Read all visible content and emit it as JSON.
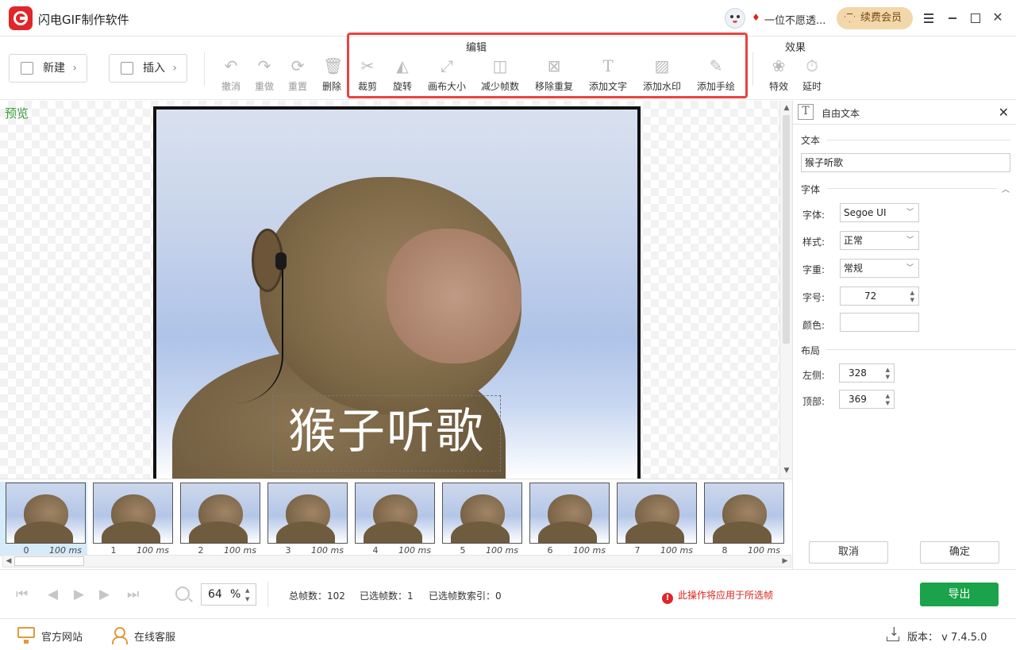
{
  "app": {
    "title": "闪电GIF制作软件",
    "username": "一位不愿透...",
    "renew_label": "续费会员"
  },
  "toolbar": {
    "new_label": "新建",
    "insert_label": "插入",
    "edit_group_title": "编辑",
    "effects_group_title": "效果",
    "history": [
      {
        "label": "撤消",
        "icon": "undo-icon"
      },
      {
        "label": "重做",
        "icon": "redo-icon"
      },
      {
        "label": "重置",
        "icon": "reset-icon"
      },
      {
        "label": "删除",
        "icon": "trash-icon"
      }
    ],
    "edit_items": [
      {
        "label": "裁剪",
        "icon": "scissors-icon"
      },
      {
        "label": "旋转",
        "icon": "rotate-icon"
      },
      {
        "label": "画布大小",
        "icon": "resize-canvas-icon"
      },
      {
        "label": "减少帧数",
        "icon": "reduce-frames-icon"
      },
      {
        "label": "移除重复",
        "icon": "remove-duplicate-icon"
      },
      {
        "label": "添加文字",
        "icon": "text-icon"
      },
      {
        "label": "添加水印",
        "icon": "watermark-icon"
      },
      {
        "label": "添加手绘",
        "icon": "pencil-icon"
      }
    ],
    "effect_items": [
      {
        "label": "特效",
        "icon": "effects-icon"
      },
      {
        "label": "延时",
        "icon": "timer-icon"
      }
    ]
  },
  "preview": {
    "label": "预览",
    "overlay_text": "猴子听歌"
  },
  "filmstrip": {
    "frames": [
      {
        "index": "0",
        "duration": "100 ms"
      },
      {
        "index": "1",
        "duration": "100 ms"
      },
      {
        "index": "2",
        "duration": "100 ms"
      },
      {
        "index": "3",
        "duration": "100 ms"
      },
      {
        "index": "4",
        "duration": "100 ms"
      },
      {
        "index": "5",
        "duration": "100 ms"
      },
      {
        "index": "6",
        "duration": "100 ms"
      },
      {
        "index": "7",
        "duration": "100 ms"
      },
      {
        "index": "8",
        "duration": "100 ms"
      }
    ],
    "selected_index": 0
  },
  "panel": {
    "title": "自由文本",
    "text_section": "文本",
    "text_value": "猴子听歌",
    "font_section": "字体",
    "font_label": "字体:",
    "font_value": "Segoe UI",
    "style_label": "样式:",
    "style_value": "正常",
    "weight_label": "字重:",
    "weight_value": "常规",
    "size_label": "字号:",
    "size_value": "72",
    "color_label": "颜色:",
    "color_value": "#ffffff",
    "layout_section": "布局",
    "left_label": "左侧:",
    "left_value": "328",
    "top_label": "顶部:",
    "top_value": "369",
    "cancel_label": "取消",
    "ok_label": "确定"
  },
  "controls": {
    "zoom_value": "64",
    "zoom_unit": "%",
    "total_frames": "总帧数：102",
    "selected_frames": "已选帧数：1",
    "selected_index": "已选帧数索引：0",
    "warning": "此操作将应用于所选帧",
    "export_label": "导出"
  },
  "statusbar": {
    "website": "官方网站",
    "support": "在线客服",
    "version": "版本： v 7.4.5.0"
  },
  "colors": {
    "accent_red": "#e8443f",
    "export_green": "#1aa34a",
    "preview_green": "#3c9a3c",
    "warning_red": "#d9251d"
  }
}
